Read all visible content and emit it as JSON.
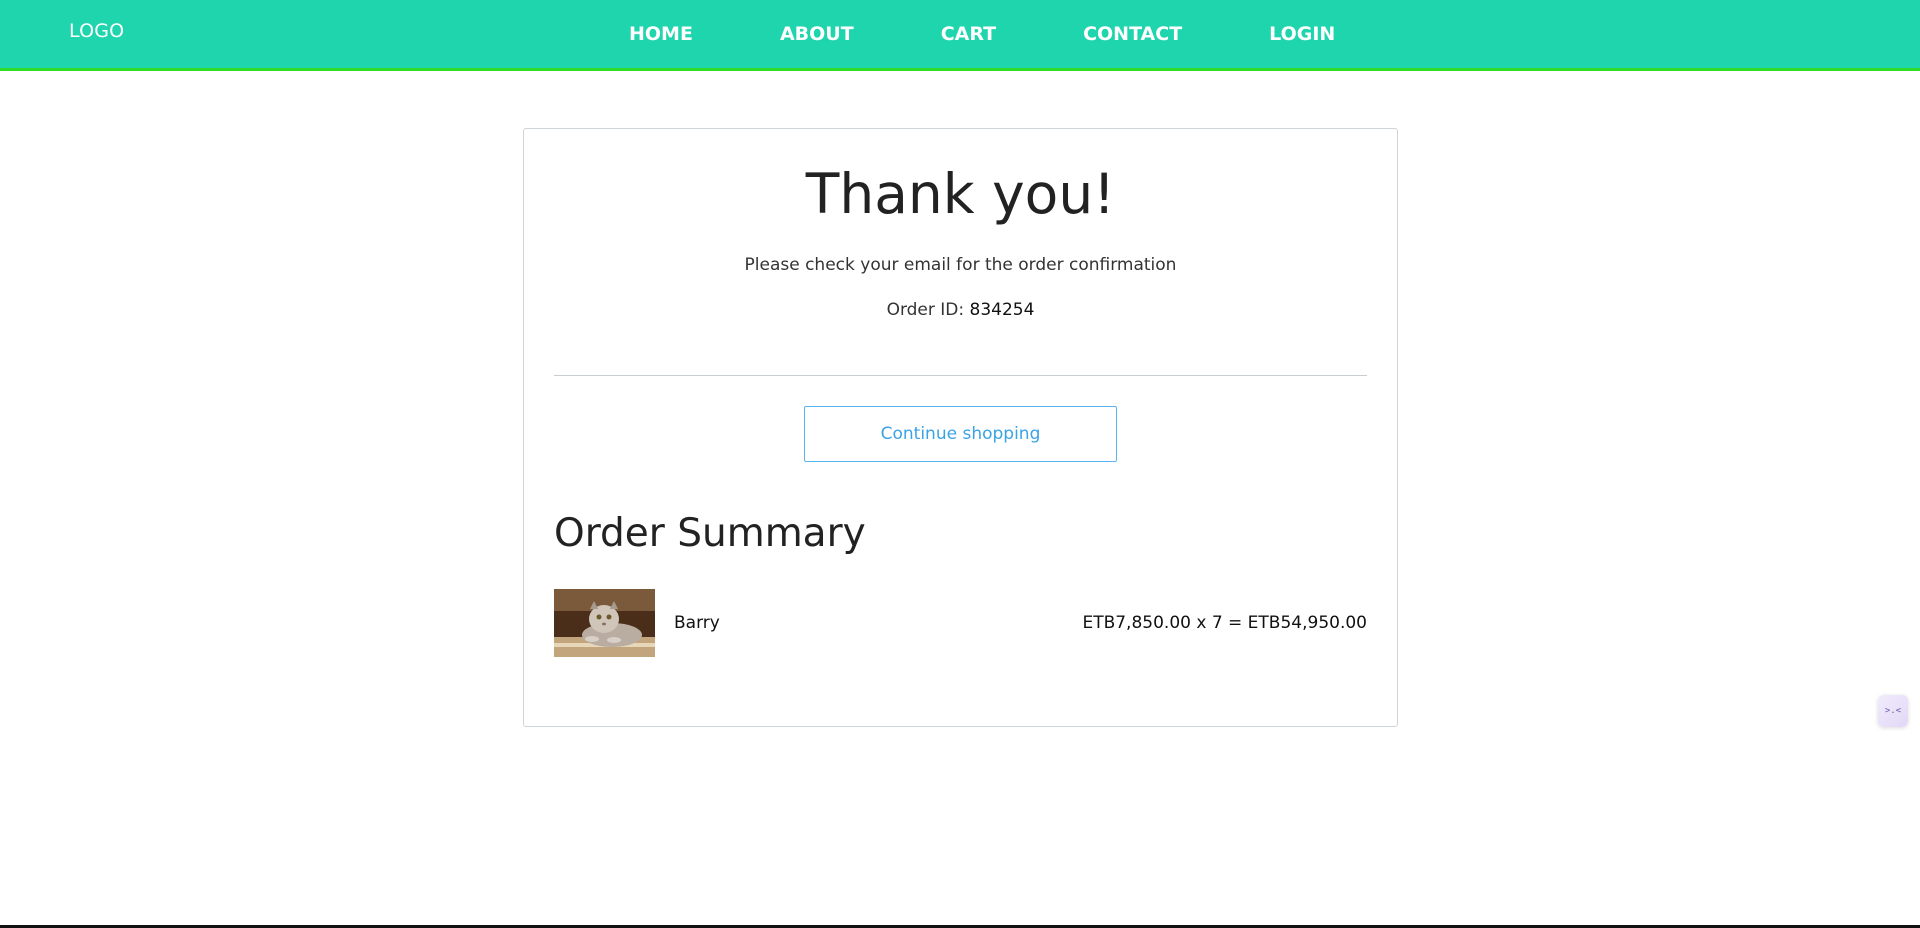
{
  "navbar": {
    "logo": "LOGO",
    "links": [
      "HOME",
      "ABOUT",
      "CART",
      "CONTACT",
      "LOGIN"
    ],
    "background_color": "#1fd5ad",
    "border_color": "#2fdc2a"
  },
  "confirmation": {
    "title": "Thank you!",
    "message": "Please check your email for the order confirmation",
    "order_id_label": "Order ID:",
    "order_id": "834254",
    "continue_label": "Continue shopping",
    "button_color": "#3aa3e6"
  },
  "summary": {
    "title": "Order Summary",
    "items": [
      {
        "name": "Barry",
        "price_line": "ETB7,850.00 x 7 = ETB54,950.00",
        "image_icon": "cat-photo"
      }
    ]
  },
  "widget": {
    "icon": "chat-face-icon",
    "glyph": ">.<"
  }
}
